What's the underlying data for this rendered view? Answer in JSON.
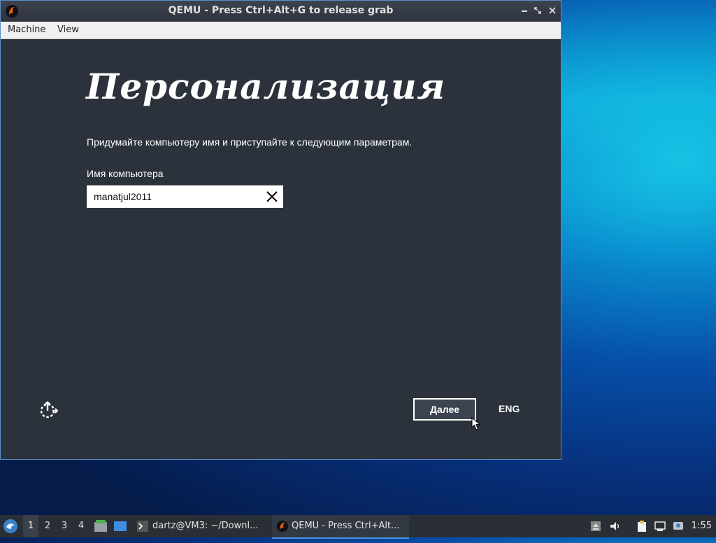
{
  "window": {
    "title": "QEMU - Press Ctrl+Alt+G to release grab",
    "menu": [
      "Machine",
      "View"
    ]
  },
  "guest": {
    "heading": "Персонализация",
    "subtitle": "Придумайте компьютеру имя и приступайте к следующим параметрам.",
    "field_label": "Имя компьютера",
    "computer_name": "manatjul2011",
    "next_label": "Далее",
    "language": "ENG"
  },
  "taskbar": {
    "workspaces": [
      "1",
      "2",
      "3",
      "4"
    ],
    "active_workspace": "1",
    "tasks": [
      {
        "label": "dartz@VM3: ~/Downl..."
      },
      {
        "label": "QEMU - Press Ctrl+Alt..."
      }
    ],
    "clock": "1:55"
  },
  "icons": {
    "app": "qemu-icon",
    "accessibility": "ease-of-access-icon",
    "clear": "close-icon"
  },
  "colors": {
    "guest_bg": "#2b323c",
    "taskbar_bg": "#2a2f36",
    "accent": "#4a90d9"
  }
}
